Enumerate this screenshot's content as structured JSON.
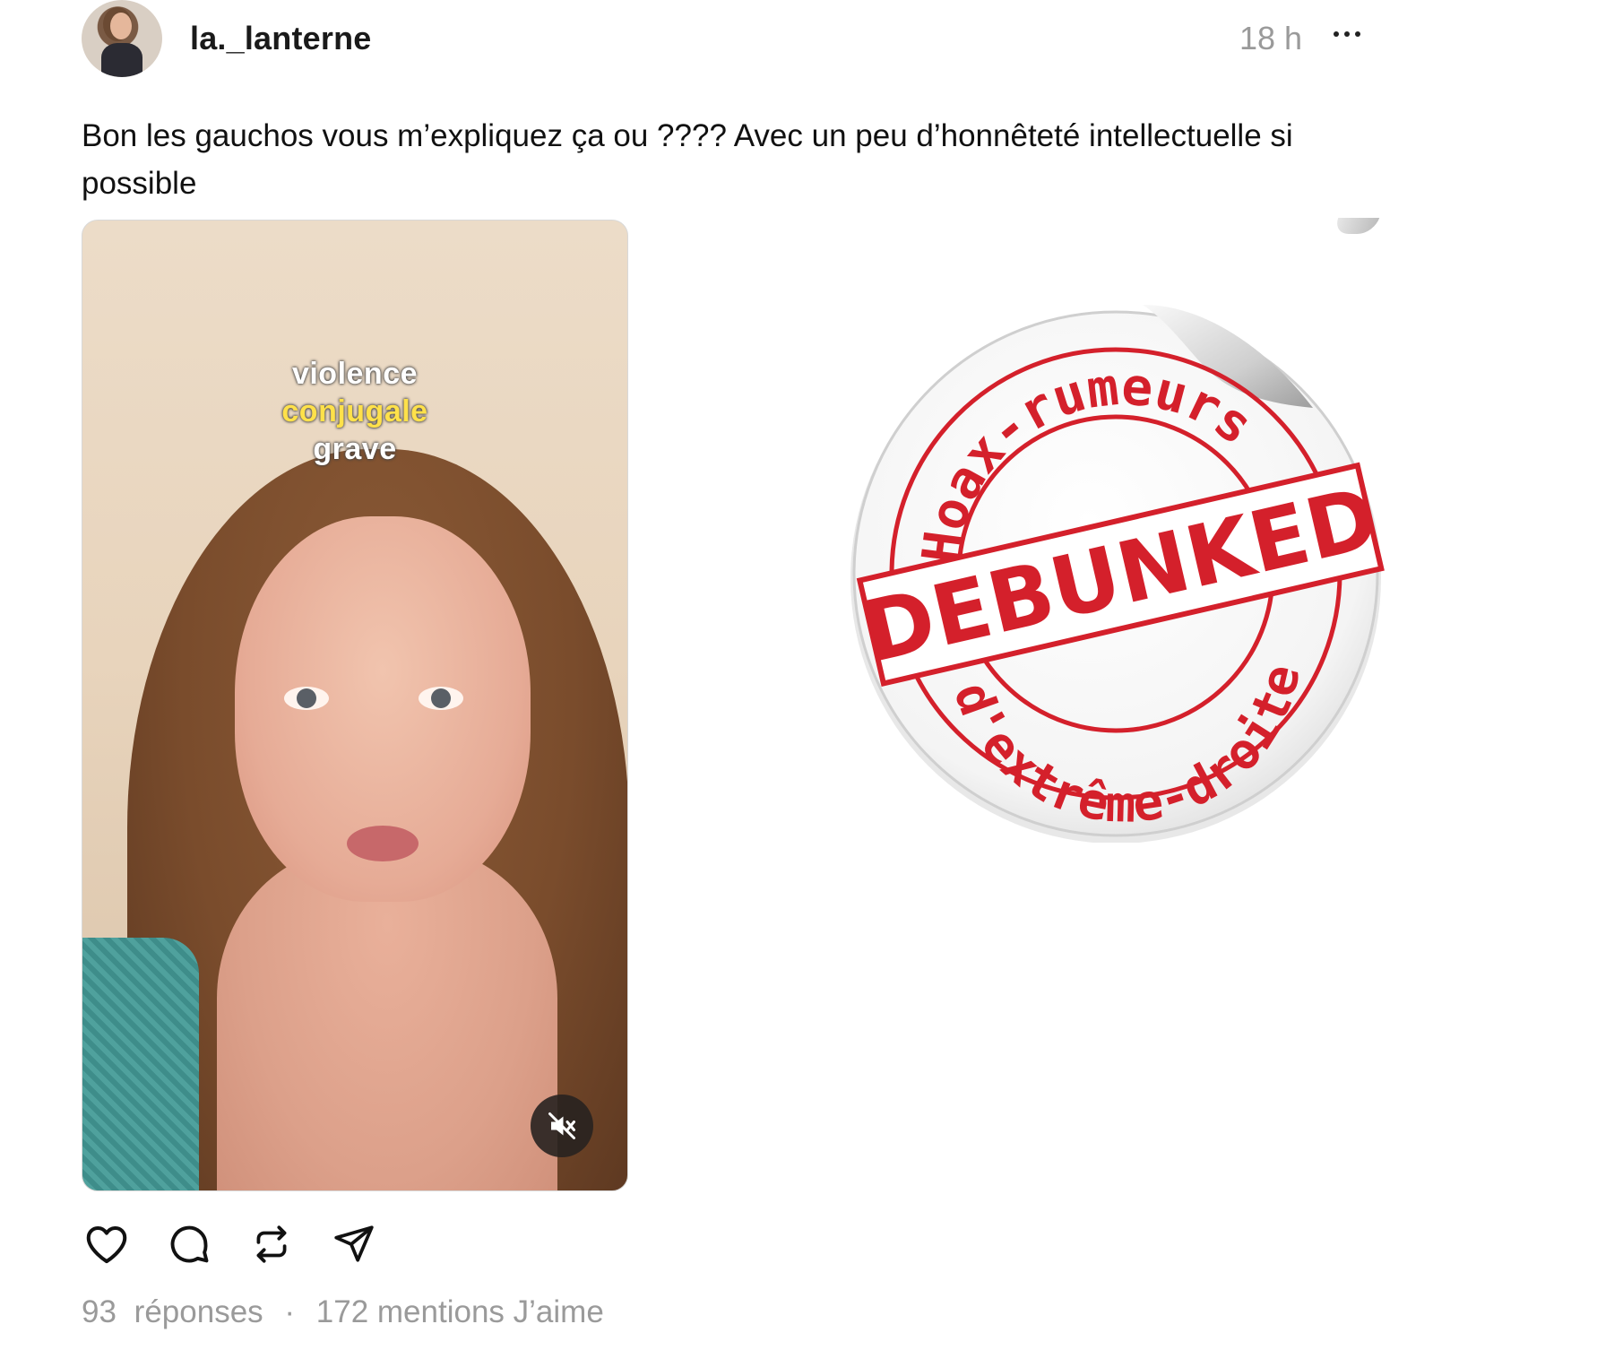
{
  "post": {
    "username": "la._lanterne",
    "time": "18 h",
    "caption": "Bon les gauchos vous m’expliquez ça ou ???? Avec un peu d’honnêteté intellectuelle si possible"
  },
  "video": {
    "overlay_line1": "violence",
    "overlay_line2": "conjugale",
    "overlay_line3": "grave",
    "muted": true
  },
  "sticker": {
    "top_arc": "Hoax-rumeurs",
    "stamp": "DEBUNKED",
    "bottom_arc": "d'extrême-droite",
    "color": "#d4202b"
  },
  "stats": {
    "replies": "93",
    "replies_label": "réponses",
    "separator": "·",
    "likes": "172 mentions J’aime"
  },
  "icons": [
    "more-icon",
    "mute-icon",
    "heart-icon",
    "comment-icon",
    "repost-icon",
    "share-icon"
  ]
}
